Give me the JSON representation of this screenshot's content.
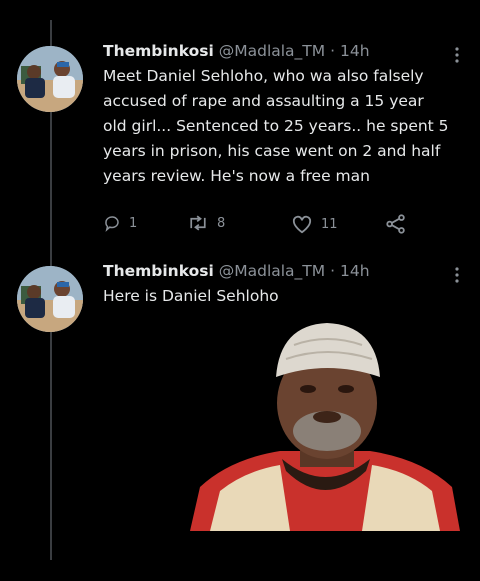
{
  "thread": [
    {
      "author_name": "Thembinkosi",
      "handle": "@Madlala_TM",
      "separator": "·",
      "time": "14h",
      "text": "Meet Daniel Sehloho, who wa also falsely accused of rape and assaulting a 15 year old girl... Sentenced to 25 years.. he spent 5 years in prison, his case went on 2 and half years review. He's now a free man",
      "reply_count": "1",
      "retweet_count": "8",
      "like_count": "11"
    },
    {
      "author_name": "Thembinkosi",
      "handle": "@Madlala_TM",
      "separator": "·",
      "time": "14h",
      "text": "Here is Daniel Sehloho"
    }
  ],
  "icons": {
    "reply": "reply-icon",
    "retweet": "retweet-icon",
    "like": "heart-icon",
    "share": "share-icon",
    "more": "more-options-icon"
  },
  "colors": {
    "background": "#000000",
    "text": "#e7e9ea",
    "muted": "#8b9198",
    "thread_line": "#3a3d41"
  }
}
